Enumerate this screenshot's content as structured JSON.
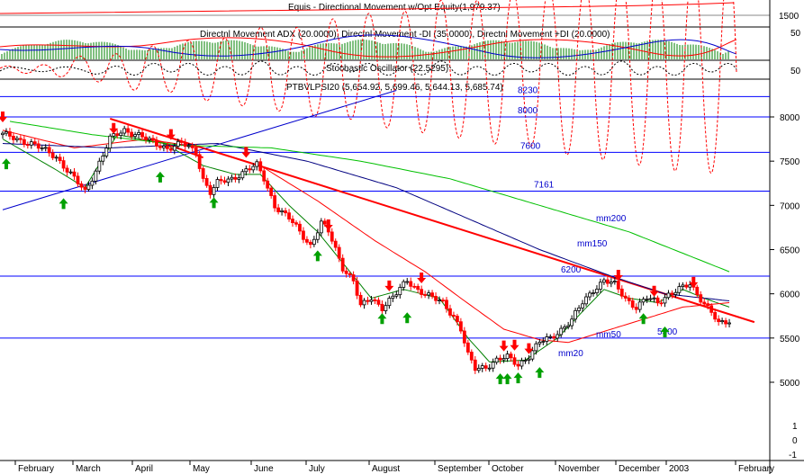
{
  "panels": {
    "equity": {
      "title": "Equis - Directional Movement  w/Opt Equity(1,979.37)",
      "ticks": [
        "1500"
      ]
    },
    "dmi": {
      "title": "Directnl Movement ADX (20.0000), Directnl Movement -DI (35.0000), Directnl Movement +DI (20.0000)",
      "ticks": [
        "50"
      ]
    },
    "stoch": {
      "title": "Stochastic Oscillator (22.5295)",
      "ticks": [
        "50"
      ]
    },
    "price": {
      "title": "PTBVLPSI20 (5,654.92, 5,699.46, 5,644.13, 5,685.74)"
    }
  },
  "colors": {
    "up": "#00a000",
    "down": "#ff0000",
    "level": "#0000ff",
    "trend_down": "#ff0000",
    "trend_up": "#0000cc",
    "mm20": "#008000",
    "mm50": "#ff0000",
    "mm150": "#000080",
    "mm200": "#00c000",
    "label": "#0000cc"
  },
  "chart_data": {
    "type": "candlestick",
    "y_axis": {
      "min": 4900,
      "max": 8300,
      "ticks": [
        5000,
        5500,
        6000,
        6500,
        7000,
        7500,
        8000
      ],
      "extra_ticks": [
        "1",
        "0",
        "-1"
      ]
    },
    "x_axis": {
      "labels": [
        "February",
        "March",
        "April",
        "May",
        "June",
        "July",
        "August",
        "September",
        "October",
        "November",
        "December",
        "2003",
        "February"
      ]
    },
    "levels": [
      {
        "value": 8230,
        "label": "8230"
      },
      {
        "value": 8000,
        "label": "8000"
      },
      {
        "value": 7600,
        "label": "7600"
      },
      {
        "value": 7161,
        "label": "7161"
      },
      {
        "value": 6200,
        "label": "6200"
      },
      {
        "value": 5500,
        "label": "5500"
      }
    ],
    "moving_average_labels": [
      "mm200",
      "mm150",
      "mm50",
      "mm20"
    ],
    "close_path": [
      [
        0,
        7800
      ],
      [
        8,
        7700
      ],
      [
        15,
        7550
      ],
      [
        20,
        7300
      ],
      [
        23,
        7150
      ],
      [
        26,
        7400
      ],
      [
        30,
        7750
      ],
      [
        34,
        7850
      ],
      [
        38,
        7800
      ],
      [
        42,
        7700
      ],
      [
        46,
        7650
      ],
      [
        50,
        7700
      ],
      [
        54,
        7600
      ],
      [
        56,
        7300
      ],
      [
        58,
        7150
      ],
      [
        60,
        7250
      ],
      [
        64,
        7300
      ],
      [
        68,
        7400
      ],
      [
        71,
        7450
      ],
      [
        73,
        7300
      ],
      [
        76,
        7000
      ],
      [
        80,
        6850
      ],
      [
        84,
        6650
      ],
      [
        86,
        6550
      ],
      [
        89,
        6800
      ],
      [
        91,
        6700
      ],
      [
        95,
        6300
      ],
      [
        98,
        6150
      ],
      [
        100,
        5850
      ],
      [
        103,
        5950
      ],
      [
        106,
        5850
      ],
      [
        110,
        6000
      ],
      [
        113,
        6150
      ],
      [
        116,
        6050
      ],
      [
        120,
        5950
      ],
      [
        123,
        5900
      ],
      [
        126,
        5750
      ],
      [
        128,
        5600
      ],
      [
        130,
        5300
      ],
      [
        132,
        5150
      ],
      [
        135,
        5180
      ],
      [
        138,
        5250
      ],
      [
        141,
        5280
      ],
      [
        144,
        5200
      ],
      [
        147,
        5300
      ],
      [
        150,
        5450
      ],
      [
        153,
        5500
      ],
      [
        156,
        5600
      ],
      [
        159,
        5700
      ],
      [
        162,
        5900
      ],
      [
        165,
        6050
      ],
      [
        168,
        6150
      ],
      [
        171,
        6100
      ],
      [
        174,
        5950
      ],
      [
        177,
        5850
      ],
      [
        180,
        5950
      ],
      [
        183,
        5900
      ],
      [
        186,
        6000
      ],
      [
        189,
        6050
      ],
      [
        192,
        6100
      ],
      [
        195,
        5950
      ],
      [
        198,
        5800
      ],
      [
        200,
        5650
      ],
      [
        203,
        5685
      ]
    ],
    "ma_paths": {
      "mm20": [
        [
          0,
          7750
        ],
        [
          15,
          7400
        ],
        [
          23,
          7200
        ],
        [
          32,
          7800
        ],
        [
          45,
          7700
        ],
        [
          56,
          7450
        ],
        [
          65,
          7350
        ],
        [
          72,
          7350
        ],
        [
          80,
          7000
        ],
        [
          88,
          6700
        ],
        [
          96,
          6300
        ],
        [
          103,
          5950
        ],
        [
          112,
          6050
        ],
        [
          122,
          5950
        ],
        [
          130,
          5500
        ],
        [
          136,
          5230
        ],
        [
          146,
          5250
        ],
        [
          155,
          5500
        ],
        [
          162,
          5800
        ],
        [
          168,
          6050
        ],
        [
          175,
          5950
        ],
        [
          183,
          5900
        ],
        [
          190,
          6050
        ],
        [
          196,
          5950
        ],
        [
          203,
          5850
        ]
      ],
      "mm50": [
        [
          0,
          7850
        ],
        [
          20,
          7650
        ],
        [
          40,
          7750
        ],
        [
          56,
          7650
        ],
        [
          72,
          7450
        ],
        [
          88,
          7050
        ],
        [
          104,
          6600
        ],
        [
          118,
          6250
        ],
        [
          128,
          5950
        ],
        [
          140,
          5600
        ],
        [
          150,
          5480
        ],
        [
          158,
          5450
        ],
        [
          166,
          5550
        ],
        [
          178,
          5700
        ],
        [
          190,
          5850
        ],
        [
          203,
          5900
        ]
      ],
      "mm150": [
        [
          0,
          7700
        ],
        [
          30,
          7650
        ],
        [
          60,
          7700
        ],
        [
          85,
          7500
        ],
        [
          110,
          7200
        ],
        [
          130,
          6850
        ],
        [
          150,
          6500
        ],
        [
          170,
          6200
        ],
        [
          185,
          6000
        ],
        [
          203,
          5920
        ]
      ],
      "mm200": [
        [
          2,
          7950
        ],
        [
          25,
          7800
        ],
        [
          50,
          7680
        ],
        [
          75,
          7650
        ],
        [
          100,
          7500
        ],
        [
          125,
          7300
        ],
        [
          150,
          7000
        ],
        [
          175,
          6700
        ],
        [
          203,
          6250
        ]
      ]
    },
    "trendlines": [
      {
        "from": [
          30,
          7980
        ],
        "to": [
          210,
          5680
        ],
        "color": "trend_down",
        "width": 2
      },
      {
        "from": [
          42,
          7750
        ],
        "to": [
          56,
          7540
        ],
        "color": "trend_down",
        "width": 2
      },
      {
        "from": [
          0,
          6950
        ],
        "to": [
          110,
          8300
        ],
        "color": "trend_up",
        "width": 1
      }
    ],
    "buy_signals": [
      [
        1,
        7470
      ],
      [
        17,
        7020
      ],
      [
        44,
        7320
      ],
      [
        59,
        7030
      ],
      [
        88,
        6430
      ],
      [
        106,
        5720
      ],
      [
        113,
        5730
      ],
      [
        139,
        5040
      ],
      [
        141,
        5040
      ],
      [
        144,
        5050
      ],
      [
        150,
        5110
      ],
      [
        179,
        5720
      ],
      [
        185,
        5570
      ]
    ],
    "sell_signals": [
      [
        0,
        8000
      ],
      [
        31,
        7870
      ],
      [
        47,
        7800
      ],
      [
        68,
        7600
      ],
      [
        91,
        6780
      ],
      [
        108,
        6090
      ],
      [
        117,
        6180
      ],
      [
        140,
        5410
      ],
      [
        143,
        5420
      ],
      [
        147,
        5380
      ],
      [
        172,
        6210
      ],
      [
        182,
        6030
      ],
      [
        193,
        6130
      ]
    ]
  }
}
